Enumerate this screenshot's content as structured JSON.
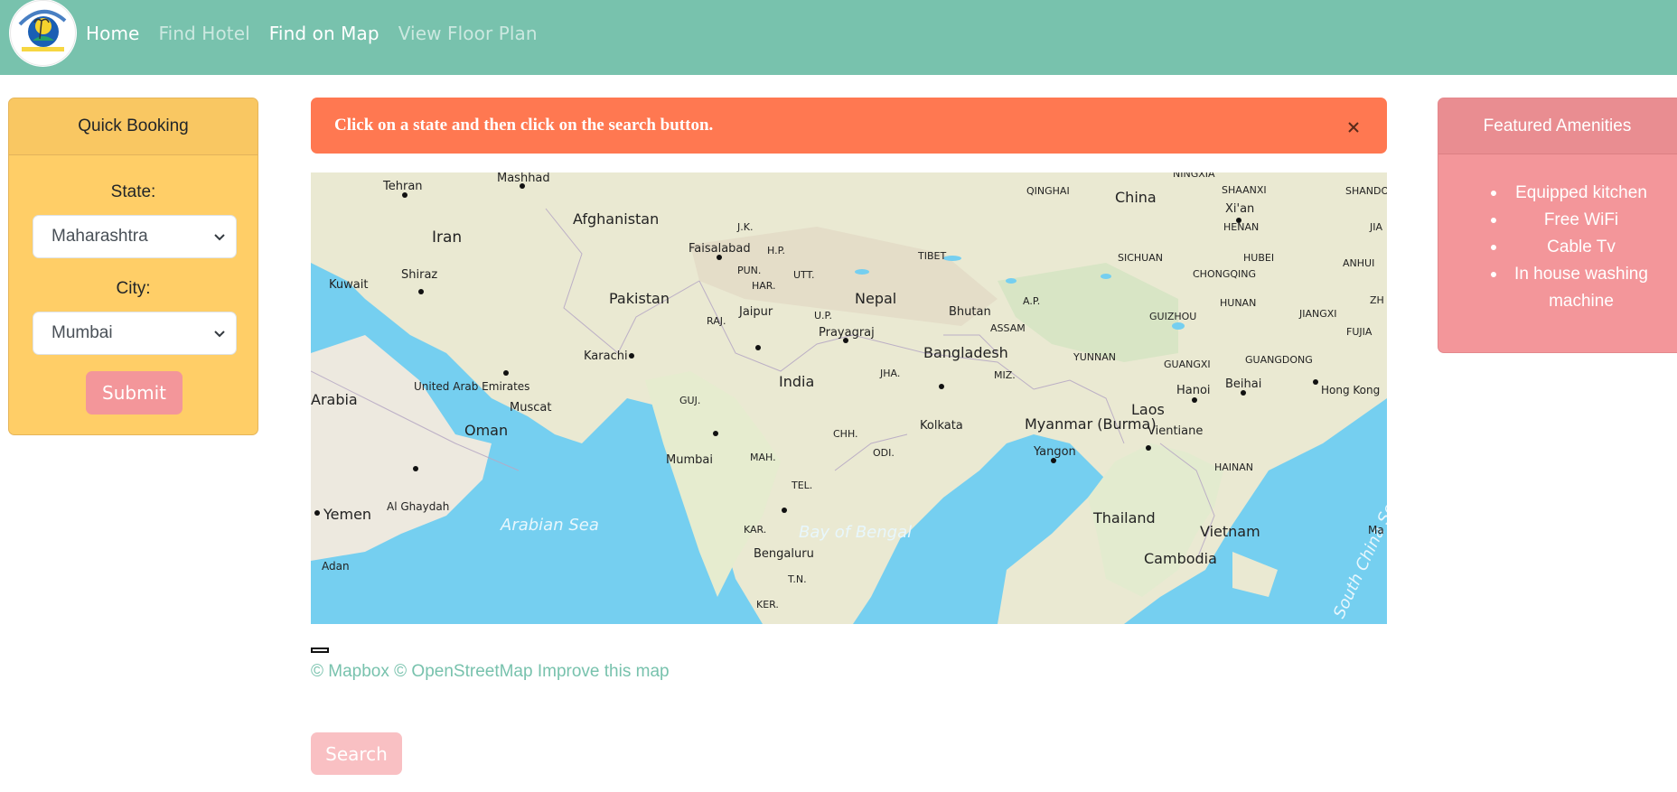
{
  "nav": {
    "items": [
      {
        "label": "Home",
        "active": true
      },
      {
        "label": "Find Hotel",
        "active": false
      },
      {
        "label": "Find on Map",
        "active": true
      },
      {
        "label": "View Floor Plan",
        "active": false
      }
    ]
  },
  "booking": {
    "title": "Quick Booking",
    "state_label": "State:",
    "state_value": "Maharashtra",
    "city_label": "City:",
    "city_value": "Mumbai",
    "submit_label": "Submit"
  },
  "alert": {
    "message": "Click on a state and then click on the search button."
  },
  "map": {
    "labels": [
      "Mashhad",
      "Tehran",
      "Iran",
      "Shiraz",
      "Kuwait",
      "Afghanistan",
      "Pakistan",
      "Karachi",
      "Faisalabad",
      "J.K.",
      "H.P.",
      "PUN.",
      "HAR.",
      "UTT.",
      "RAJ.",
      "Jaipur",
      "U.P.",
      "Prayagraj",
      "Nepal",
      "TIBET",
      "Bhutan",
      "A.P.",
      "ASSAM",
      "Bangladesh",
      "India",
      "JHA.",
      "Kolkata",
      "MIZ.",
      "Myanmar (Burma)",
      "GUJ.",
      "MAH.",
      "CHH.",
      "ODI.",
      "Mumbai",
      "TEL.",
      "KAR.",
      "Bengaluru",
      "T.N.",
      "KER.",
      "Arabian Sea",
      "Bay of Bengal",
      "United Arab Emirates",
      "Muscat",
      "Oman",
      "Arabia",
      "Al Ghaydah",
      "Yemen",
      "Adan",
      "QINGHAI",
      "China",
      "SHAANXI",
      "Xi'an",
      "HENAN",
      "SICHUAN",
      "CHONGQING",
      "HUBEI",
      "ANHUI",
      "HUNAN",
      "GUIZHOU",
      "JIANGXI",
      "FUJIA",
      "YUNNAN",
      "GUANGXI",
      "GUANGDONG",
      "Hanoi",
      "Beihai",
      "Hong Kong",
      "Laos",
      "Vientiane",
      "HAINAN",
      "Yangon",
      "Thailand",
      "Vietnam",
      "Cambodia",
      "South China Sea",
      "NINGXIA",
      "SHANDO",
      "JIA",
      "ZH",
      "Ma"
    ],
    "attribution": {
      "mapbox": "© Mapbox",
      "osm": "© OpenStreetMap",
      "improve": "Improve this map"
    }
  },
  "search_label": "Search",
  "amenities": {
    "title": "Featured Amenities",
    "items": [
      "Equipped kitchen",
      "Free WiFi",
      "Cable Tv",
      "In house washing machine"
    ]
  },
  "colors": {
    "primary": "#78c2ad",
    "warning": "#ffce67",
    "danger": "#ff7851",
    "secondary": "#f3969a"
  }
}
